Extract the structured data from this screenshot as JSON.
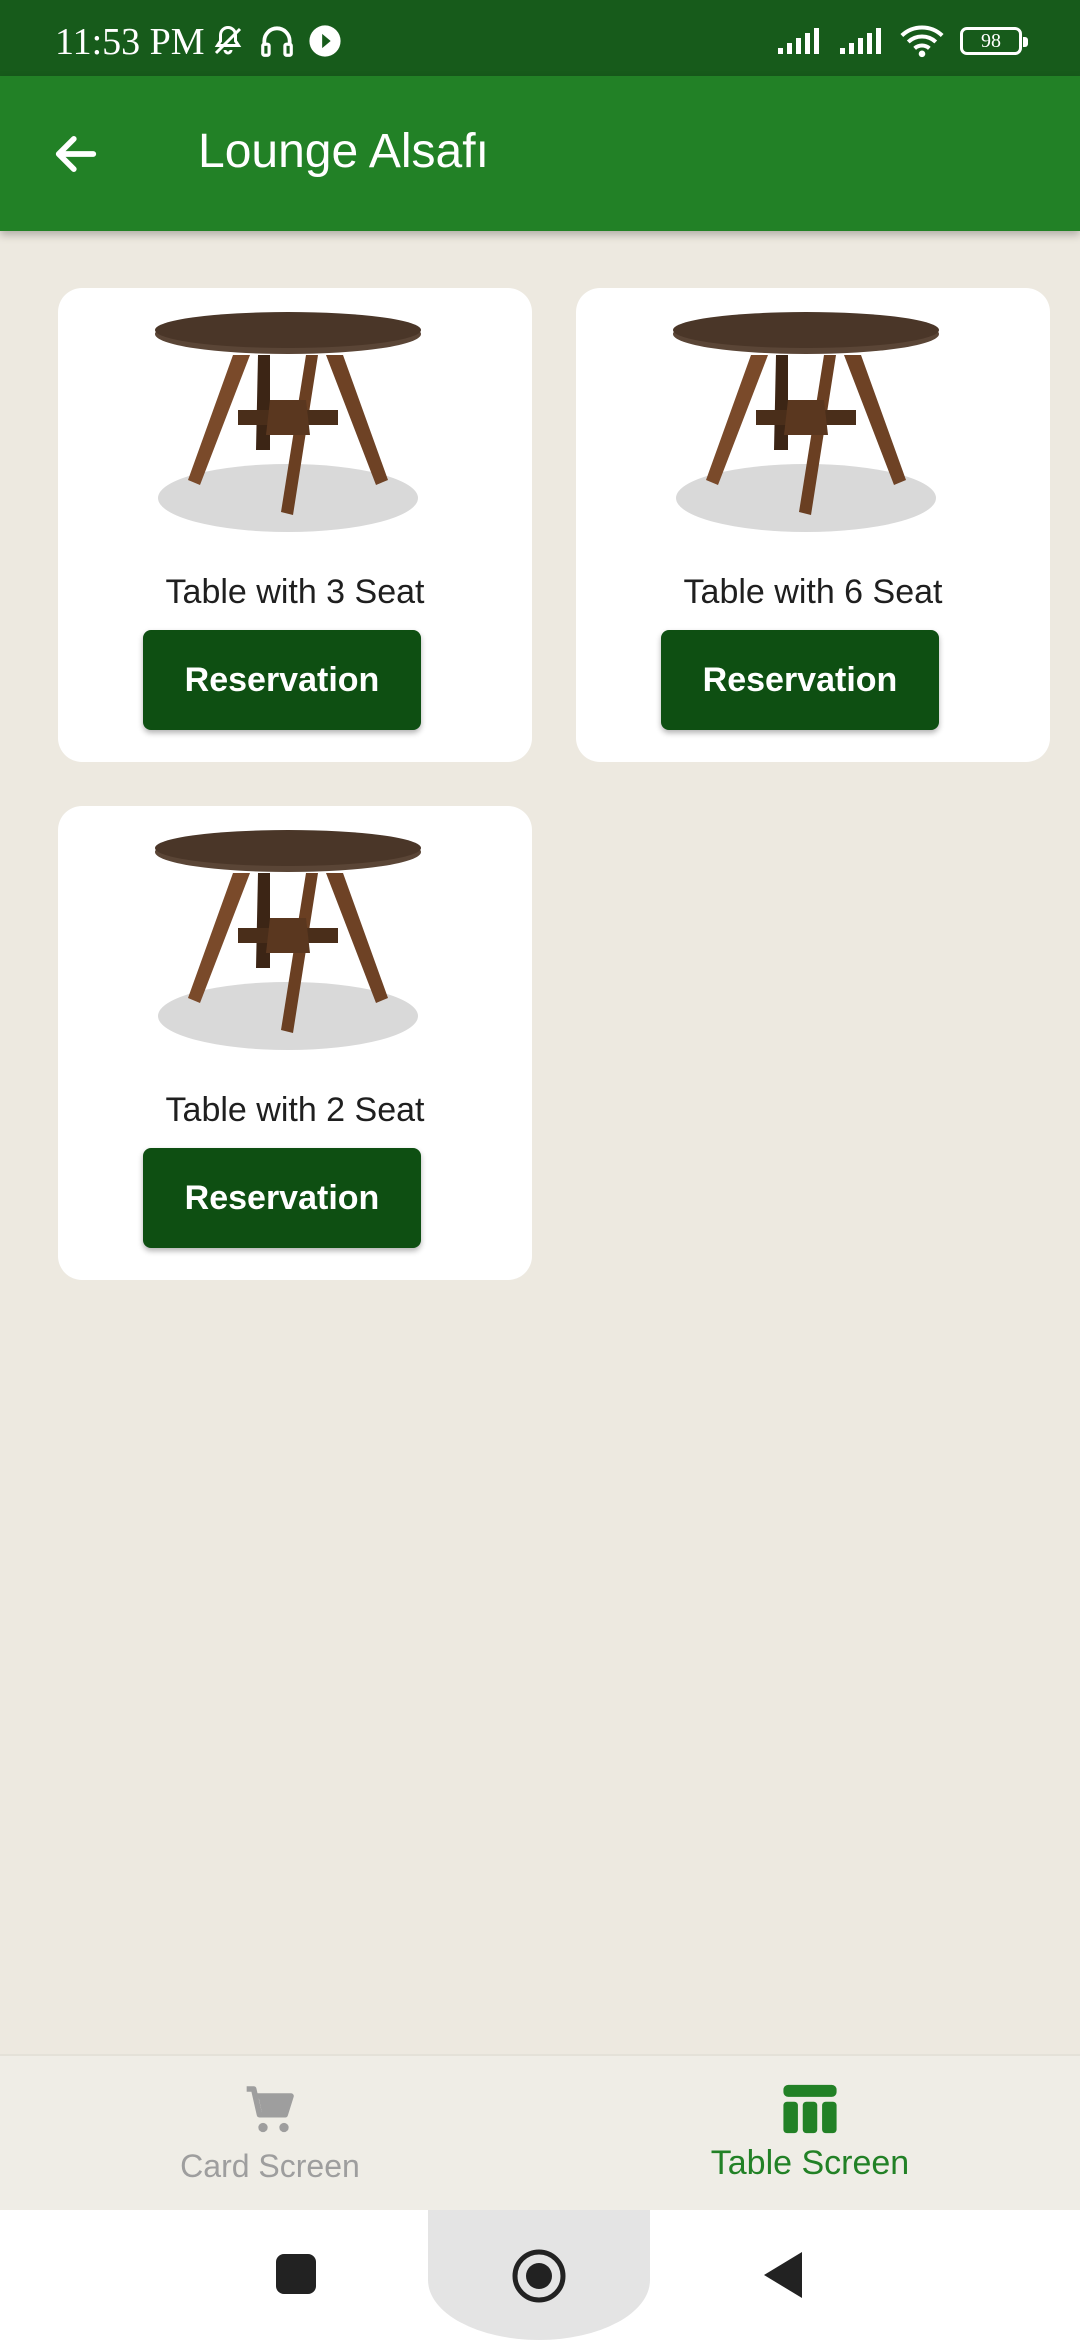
{
  "status_bar": {
    "time": "11:53 PM",
    "battery": "98",
    "icons_left": [
      "bell-off-icon",
      "headphones-icon",
      "play-icon"
    ],
    "icons_right": [
      "signal-icon",
      "signal-icon",
      "wifi-icon",
      "battery-icon"
    ]
  },
  "app_bar": {
    "title": "Lounge Alsafı",
    "back_icon": "arrow-left-icon"
  },
  "tables": [
    {
      "label": "Table with 3 Seat",
      "button": "Reservation"
    },
    {
      "label": "Table with 6 Seat",
      "button": "Reservation"
    },
    {
      "label": "Table with 2 Seat",
      "button": "Reservation"
    }
  ],
  "bottom_nav": {
    "items": [
      {
        "label": "Card Screen",
        "icon": "cart-icon",
        "active": false
      },
      {
        "label": "Table Screen",
        "icon": "table-icon",
        "active": true
      }
    ],
    "active_color": "#228126",
    "inactive_color": "#9E9E9E"
  },
  "colors": {
    "status_bar": "#175B1B",
    "app_bar": "#228126",
    "button": "#0E4F12",
    "background": "#EDE9E0"
  }
}
